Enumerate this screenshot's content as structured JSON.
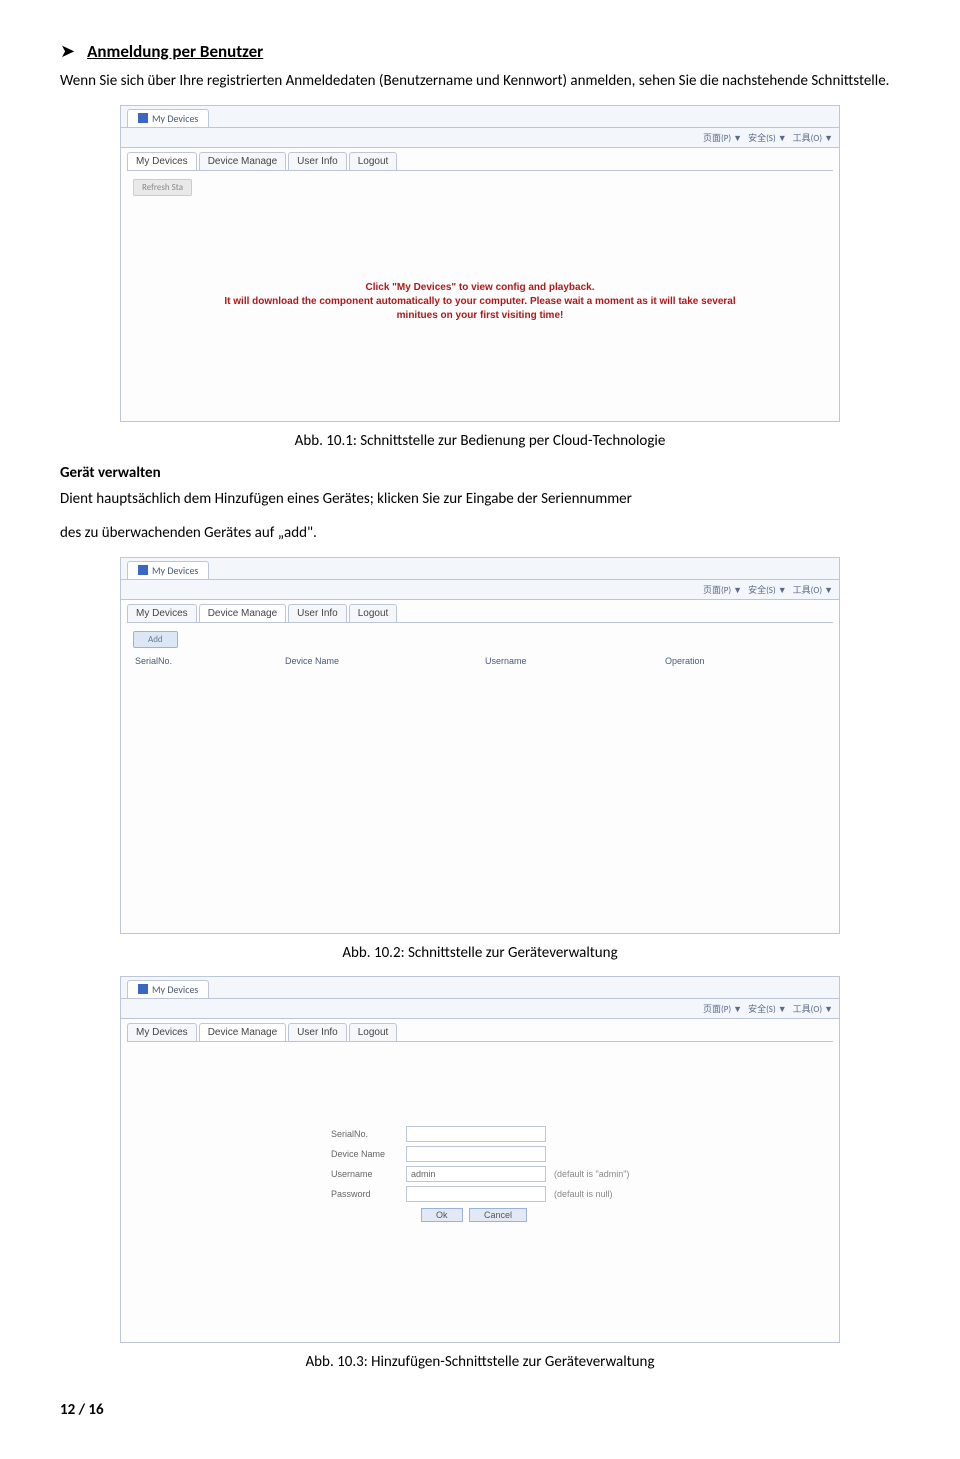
{
  "heading": "Anmeldung per Benutzer",
  "intro": "Wenn Sie sich über Ihre registrierten Anmeldedaten (Benutzername und Kennwort) anmelden, sehen Sie die nachstehende Schnittstelle.",
  "browser": {
    "tab_title": "My Devices",
    "toolbar_items": [
      "页面(P) ▼",
      "安全(S) ▼",
      "工具(O) ▼"
    ]
  },
  "nav": {
    "my_devices": "My Devices",
    "device_manage": "Device Manage",
    "user_info": "User Info",
    "logout": "Logout"
  },
  "screen1": {
    "refresh": "Refresh Sta",
    "message": "Click \"My Devices\" to view config and playback.\nIt will download the component automatically to your computer. Please wait a moment as it will take several minitues on your first visiting time!"
  },
  "caption1": "Abb. 10.1: Schnittstelle zur Bedienung per Cloud-Technologie",
  "subhead": "Gerät verwalten",
  "para2a": "Dient hauptsächlich dem Hinzufügen eines Gerätes; klicken Sie zur Eingabe der Seriennummer",
  "para2b": "des zu überwachenden Gerätes auf „add\".",
  "screen2": {
    "add": "Add",
    "cols": {
      "serial": "SerialNo.",
      "name": "Device Name",
      "user": "Username",
      "op": "Operation"
    }
  },
  "caption2": "Abb. 10.2: Schnittstelle zur Geräteverwaltung",
  "screen3": {
    "serial": "SerialNo.",
    "name": "Device Name",
    "user": "Username",
    "user_val": "admin",
    "user_hint": "(default is \"admin\")",
    "pass": "Password",
    "pass_hint": "(default is null)",
    "ok": "Ok",
    "cancel": "Cancel"
  },
  "caption3": "Abb. 10.3: Hinzufügen-Schnittstelle zur Geräteverwaltung",
  "page_footer": "12 / 16"
}
